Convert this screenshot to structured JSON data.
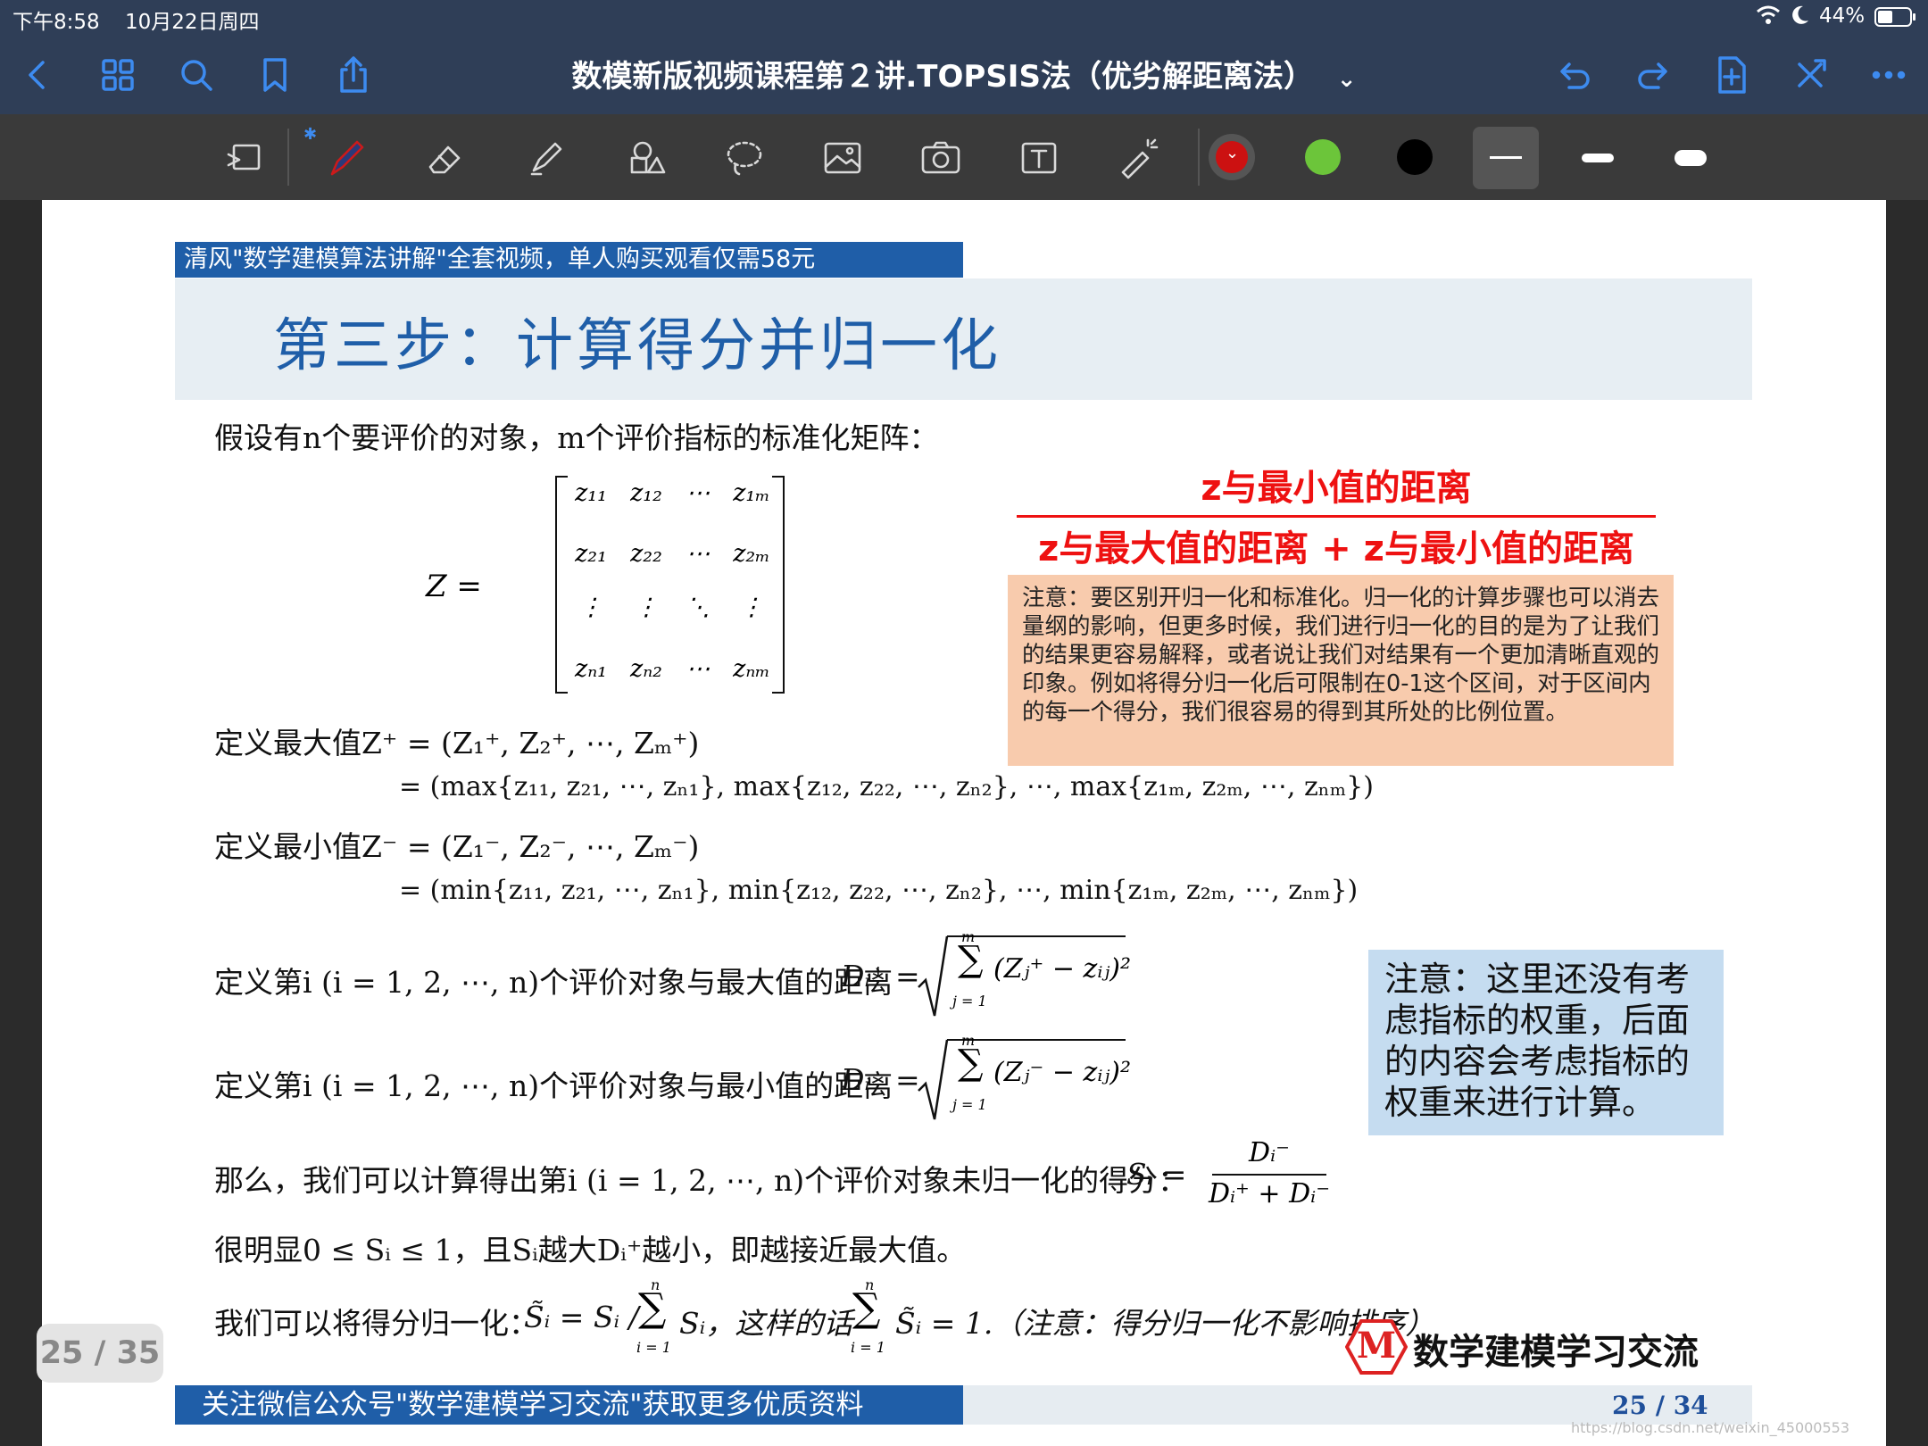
{
  "status": {
    "time": "下午8:58",
    "date": "10月22日周四",
    "battery": "44%"
  },
  "nav": {
    "title": "数模新版视频课程第２讲.TOPSIS法（优劣解距离法）",
    "title_chevron": "⌄"
  },
  "toolbar": {
    "colors": [
      "#cc1111",
      "#6cc53a",
      "#000000"
    ],
    "line_widths": [
      "thin",
      "medium",
      "thick"
    ]
  },
  "slide": {
    "promo": "清风\"数学建模算法讲解\"全套视频，单人购买观看仅需58元",
    "title": "第三步：计算得分并归一化",
    "intro": "假设有n个要评价的对象，m个评价指标的标准化矩阵：",
    "matrix": {
      "lhs": "Z  =",
      "rows": [
        [
          "z₁₁",
          "z₁₂",
          "⋯",
          "z₁ₘ"
        ],
        [
          "z₂₁",
          "z₂₂",
          "⋯",
          "z₂ₘ"
        ],
        [
          "⋮",
          "⋮",
          "⋱",
          "⋮"
        ],
        [
          "zₙ₁",
          "zₙ₂",
          "⋯",
          "zₙₘ"
        ]
      ]
    },
    "fraction_numerator": "z与最小值的距离",
    "fraction_denominator": "z与最大值的距离 + z与最小值的距离",
    "note_orange": "注意：要区别开归一化和标准化。归一化的计算步骤也可以消去量纲的影响，但更多时候，我们进行归一化的目的是为了让我们的结果更容易解释，或者说让我们对结果有一个更加清晰直观的印象。例如将得分归一化后可限制在0-1这个区间，对于区间内的每一个得分，我们很容易的得到其所处的比例位置。",
    "max_def_1": "定义最大值Z⁺ = (Z₁⁺, Z₂⁺, ⋯, Zₘ⁺)",
    "max_def_2": "= (max{z₁₁, z₂₁, ⋯, zₙ₁}, max{z₁₂, z₂₂, ⋯, zₙ₂}, ⋯, max{z₁ₘ, z₂ₘ, ⋯, zₙₘ})",
    "min_def_1": "定义最小值Z⁻ = (Z₁⁻, Z₂⁻, ⋯, Zₘ⁻)",
    "min_def_2": "= (min{z₁₁, z₂₁, ⋯, zₙ₁}, min{z₁₂, z₂₂, ⋯, zₙ₂}, ⋯, min{z₁ₘ, z₂ₘ, ⋯, zₙₘ})",
    "dplus_text": "定义第i (i = 1, 2, ⋯, n)个评价对象与最大值的距离",
    "dplus_lhs": "Dᵢ⁺ =",
    "dplus_sum_top": "m",
    "dplus_sum_bottom": "j = 1",
    "dplus_term": "(Zⱼ⁺ − zᵢⱼ)²",
    "dminus_text": "定义第i (i = 1, 2, ⋯, n)个评价对象与最小值的距离",
    "dminus_lhs": "Dᵢ⁻ =",
    "dminus_sum_top": "m",
    "dminus_sum_bottom": "j = 1",
    "dminus_term": "(Zⱼ⁻ − zᵢⱼ)²",
    "note_blue": "注意：这里还没有考虑指标的权重，后面的内容会考虑指标的权重来进行计算。",
    "score_text": "那么，我们可以计算得出第i (i = 1, 2, ⋯, n)个评价对象未归一化的得分：",
    "score_lhs": "Sᵢ  =",
    "score_num": "Dᵢ⁻",
    "score_den": "Dᵢ⁺ + Dᵢ⁻",
    "obvious": "很明显0 ≤ Sᵢ ≤ 1，且Sᵢ越大Dᵢ⁺越小，即越接近最大值。",
    "normalize_a": "我们可以将得分归一化：",
    "normalize_b": "S̃ᵢ = Sᵢ /",
    "normalize_sum_top": "n",
    "normalize_sum_bottom": "i = 1",
    "normalize_c": "Sᵢ，这样的话",
    "normalize_d": "S̃ᵢ = 1.（注意：得分归一化不影响排序）",
    "logo_letter": "M",
    "logo_text": "数学建模学习交流",
    "footer_text": "关注微信公众号\"数学建模学习交流\"获取更多优质资料",
    "footer_page": "25 / 34"
  },
  "page_badge": "25 / 35",
  "watermark": "https://blog.csdn.net/weixin_45000553"
}
